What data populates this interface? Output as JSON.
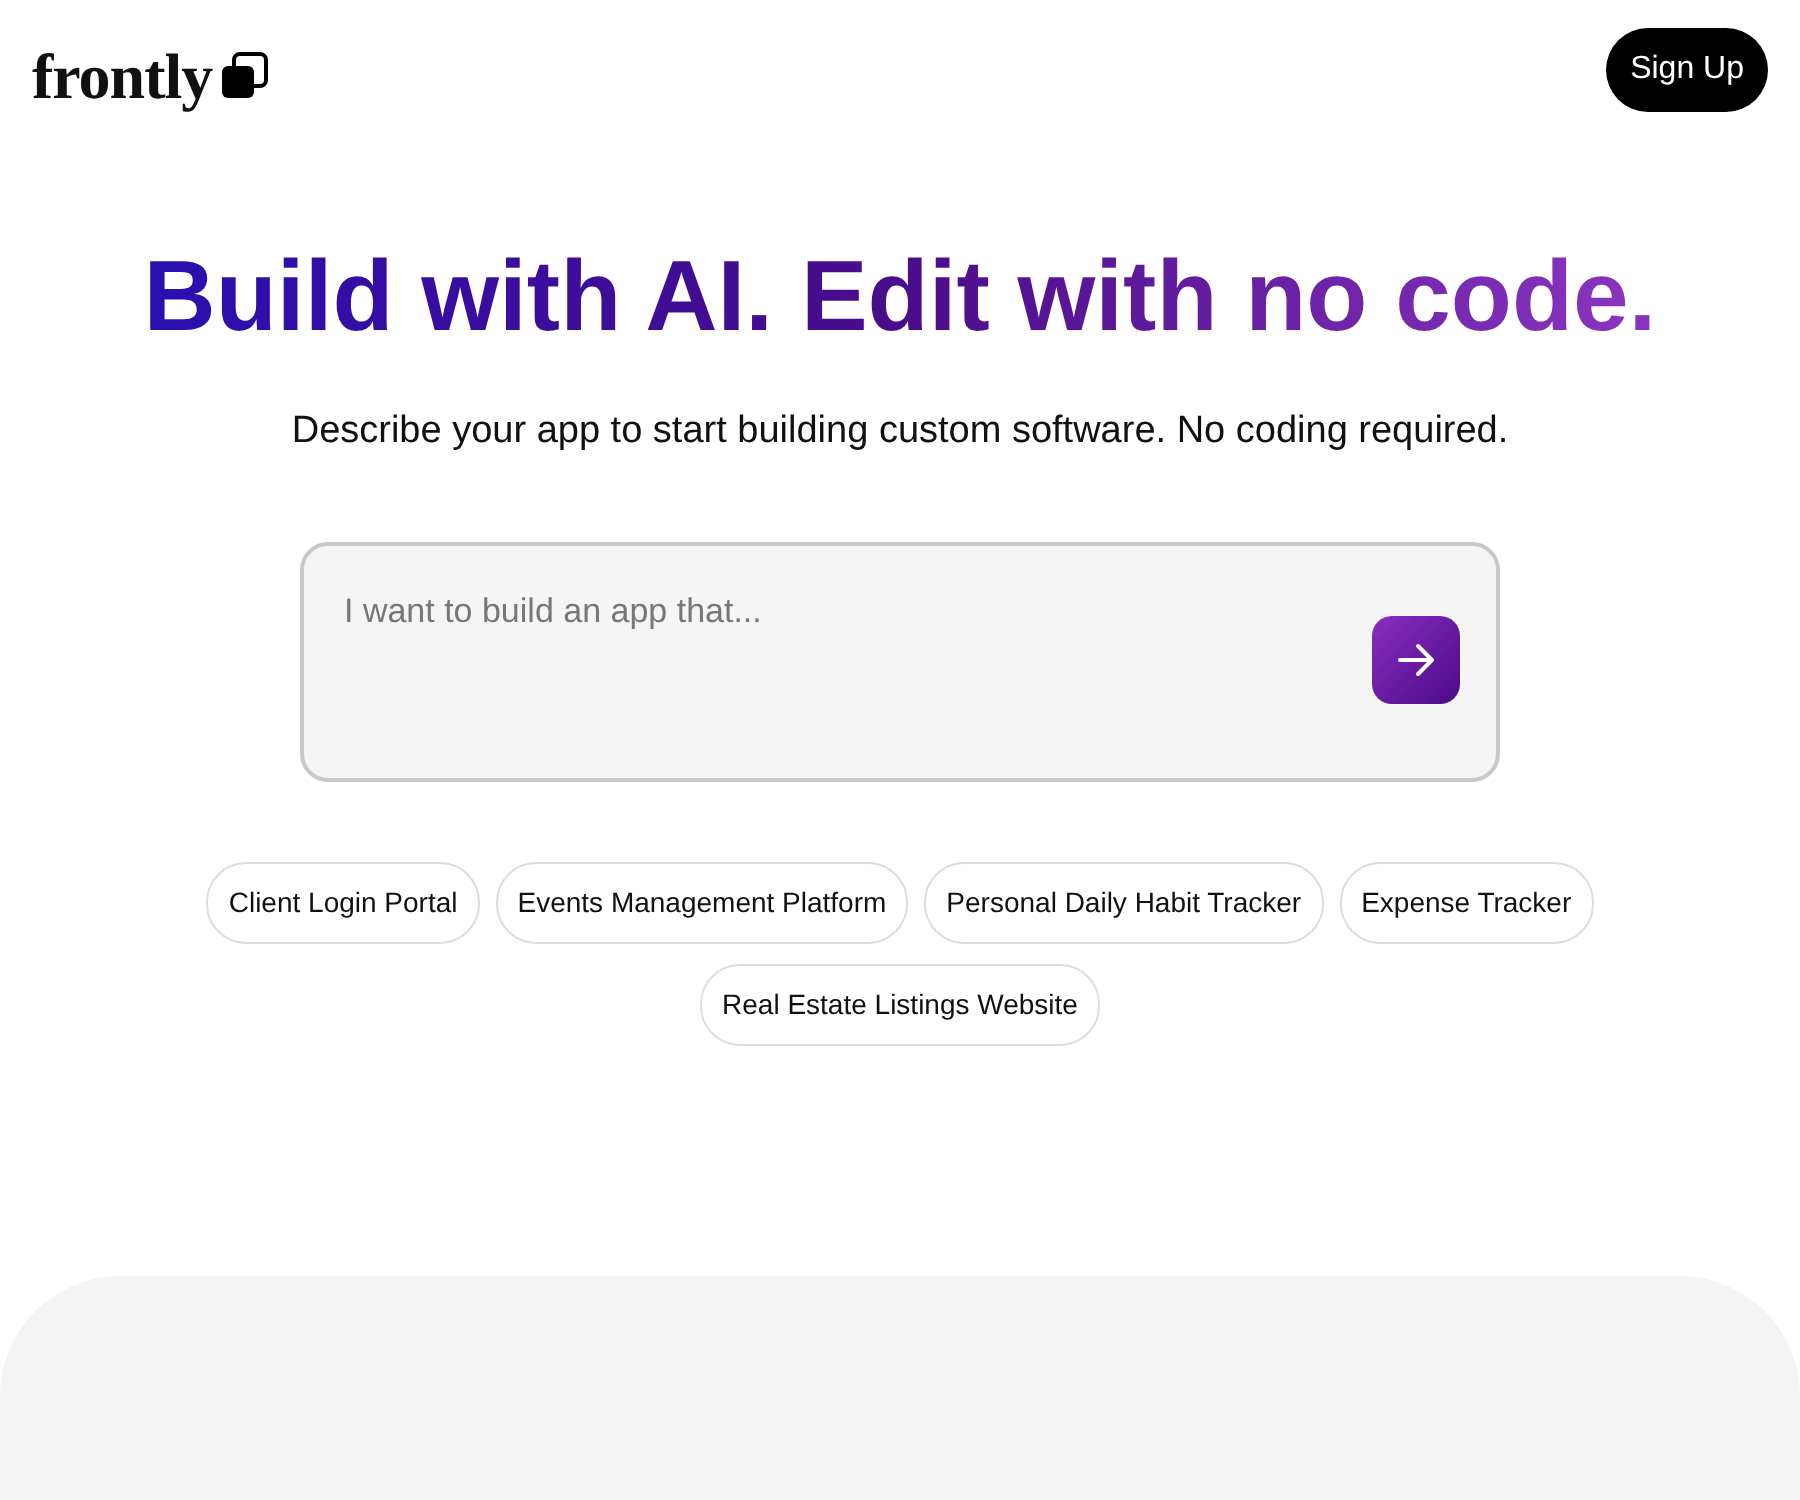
{
  "header": {
    "logo": "frontly",
    "signup_button": "Sign Up"
  },
  "hero": {
    "title": "Build with AI. Edit with no code.",
    "subtitle": "Describe your app to start building custom software. No coding required."
  },
  "prompt": {
    "placeholder": "I want to build an app that..."
  },
  "suggestions": [
    "Client Login Portal",
    "Events Management Platform",
    "Personal Daily Habit Tracker",
    "Expense Tracker",
    "Real Estate Listings Website"
  ]
}
